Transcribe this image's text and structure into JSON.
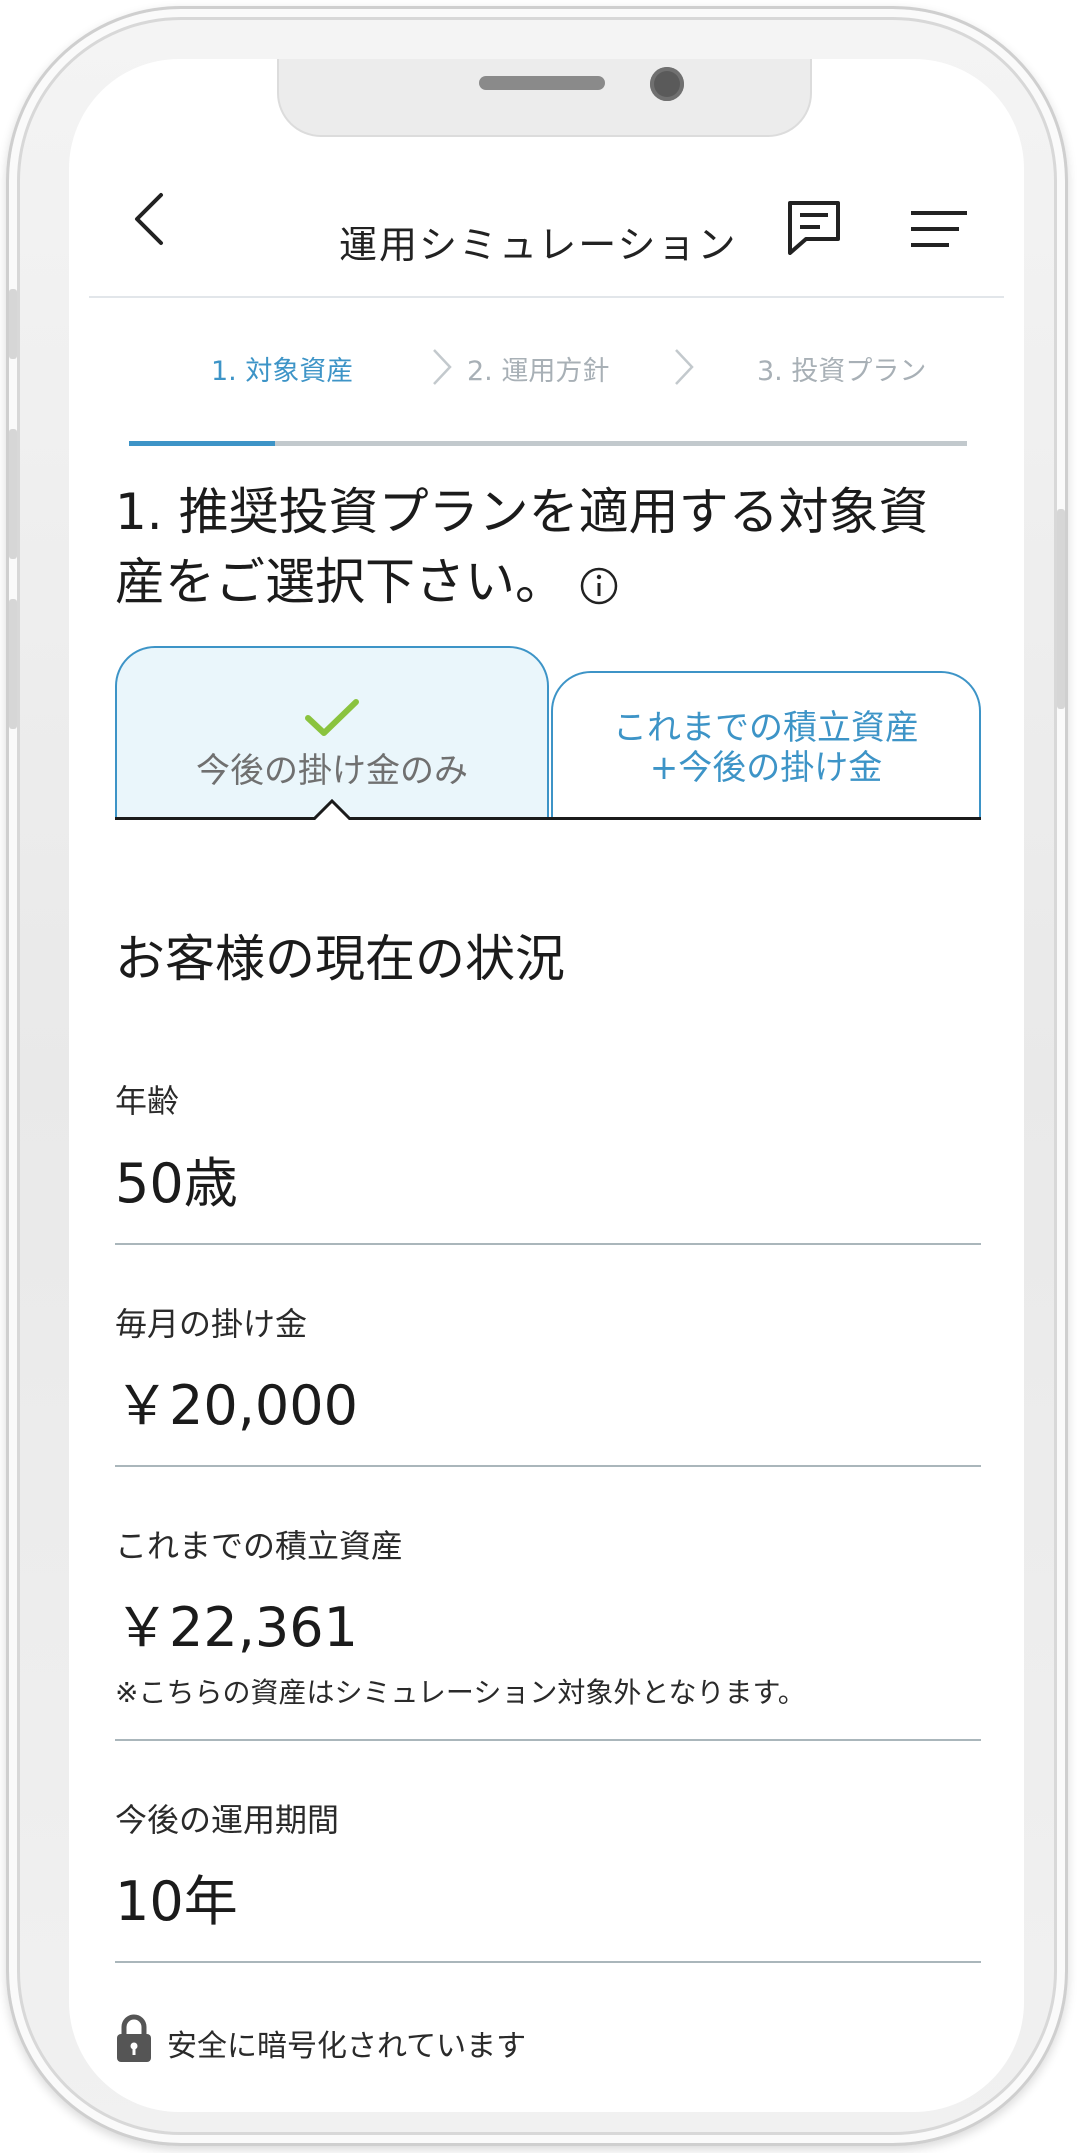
{
  "header": {
    "title": "運用シミュレーション"
  },
  "steps": [
    {
      "label": "1. 対象資産"
    },
    {
      "label": "2. 運用方針"
    },
    {
      "label": "3. 投資プラン"
    }
  ],
  "progress": {
    "fraction": 0.17
  },
  "question": {
    "text": "1. 推奨投資プランを適用する対象資産をご選択下さい。"
  },
  "options": [
    {
      "label": "今後の掛け金のみ",
      "selected": true
    },
    {
      "label_line1": "これまでの積立資産",
      "label_line2": "+今後の掛け金",
      "selected": false
    }
  ],
  "status": {
    "heading": "お客様の現在の状況",
    "age": {
      "label": "年齢",
      "value": "50歳"
    },
    "monthly": {
      "label": "毎月の掛け金",
      "value": "￥20,000"
    },
    "accumulated": {
      "label": "これまでの積立資産",
      "value": "￥22,361",
      "note": "※こちらの資産はシミュレーション対象外となります。"
    },
    "period": {
      "label": "今後の運用期間",
      "value": "10年"
    }
  },
  "footer": {
    "secure_text": "安全に暗号化されています"
  },
  "colors": {
    "accent": "#3d94c7",
    "check": "#8ac33e",
    "selected_bg": "#eaf6fb"
  }
}
